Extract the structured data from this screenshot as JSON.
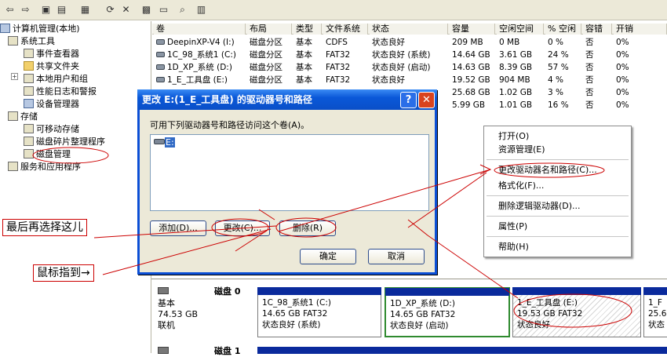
{
  "toolbar": {
    "icons": [
      "back-icon",
      "forward-icon",
      "up-folder-icon",
      "show-tree-icon",
      "properties-icon",
      "refresh-icon",
      "delete-icon",
      "settings-icon",
      "open-icon",
      "find-icon",
      "help-icon"
    ]
  },
  "tree": {
    "root": "计算机管理(本地)",
    "system_tools": "系统工具",
    "event_viewer": "事件查看器",
    "shared_folders": "共享文件夹",
    "local_users": "本地用户和组",
    "perf_logs": "性能日志和警报",
    "device_manager": "设备管理器",
    "storage": "存储",
    "removable": "可移动存储",
    "defrag": "磁盘碎片整理程序",
    "disk_mgmt": "磁盘管理",
    "services": "服务和应用程序"
  },
  "volumes": {
    "headers": [
      "卷",
      "布局",
      "类型",
      "文件系统",
      "状态",
      "容量",
      "空闲空间",
      "% 空闲",
      "容错",
      "开销"
    ],
    "rows": [
      [
        "DeepinXP-V4 (I:)",
        "磁盘分区",
        "基本",
        "CDFS",
        "状态良好",
        "209 MB",
        "0 MB",
        "0 %",
        "否",
        "0%"
      ],
      [
        "1C_98_系统1 (C:)",
        "磁盘分区",
        "基本",
        "FAT32",
        "状态良好 (系统)",
        "14.64 GB",
        "3.61 GB",
        "24 %",
        "否",
        "0%"
      ],
      [
        "1D_XP_系统 (D:)",
        "磁盘分区",
        "基本",
        "FAT32",
        "状态良好 (启动)",
        "14.63 GB",
        "8.39 GB",
        "57 %",
        "否",
        "0%"
      ],
      [
        "1_E_工具盘 (E:)",
        "磁盘分区",
        "基本",
        "FAT32",
        "状态良好",
        "19.52 GB",
        "904 MB",
        "4 %",
        "否",
        "0%"
      ],
      [
        "",
        "",
        "",
        "",
        "",
        "25.68 GB",
        "1.02 GB",
        "3 %",
        "否",
        "0%"
      ],
      [
        "",
        "",
        "",
        "",
        "",
        "5.99 GB",
        "1.01 GB",
        "16 %",
        "否",
        "0%"
      ]
    ]
  },
  "dialog": {
    "title": "更改 E:(1_E_工具盘) 的驱动器号和路径",
    "help": "?",
    "close": "✕",
    "instruction": "可用下列驱动器号和路径访问这个卷(A)。",
    "list_item": "E:",
    "add": "添加(D)...",
    "change": "更改(C)...",
    "remove": "删除(R)",
    "ok": "确定",
    "cancel": "取消"
  },
  "menu": {
    "open": "打开(O)",
    "explore": "资源管理(E)",
    "change_letter": "更改驱动器名和路径(C)...",
    "format": "格式化(F)...",
    "delete": "删除逻辑驱动器(D)...",
    "properties": "属性(P)",
    "help": "帮助(H)"
  },
  "disk0": {
    "name": "磁盘 0",
    "type": "基本",
    "size": "74.53 GB",
    "status": "联机",
    "partitions": [
      {
        "name": "1C_98_系统1 (C:)",
        "size": "14.65 GB FAT32",
        "status": "状态良好 (系统)"
      },
      {
        "name": "1D_XP_系统 (D:)",
        "size": "14.65 GB FAT32",
        "status": "状态良好 (启动)"
      },
      {
        "name": "1_E_工具盘 (E:)",
        "size": "19.53 GB FAT32",
        "status": "状态良好"
      },
      {
        "name": "1_F",
        "size": "25.6",
        "status": "状态"
      }
    ]
  },
  "disk1": {
    "name": "磁盘 1"
  },
  "annotations": {
    "last_select": "最后再选择这儿",
    "mouse_point": "鼠标指到→"
  },
  "colors": {
    "title_bar": "#0a58d8",
    "annotation": "#cc0000",
    "partition_bar": "#0a2a9c"
  }
}
